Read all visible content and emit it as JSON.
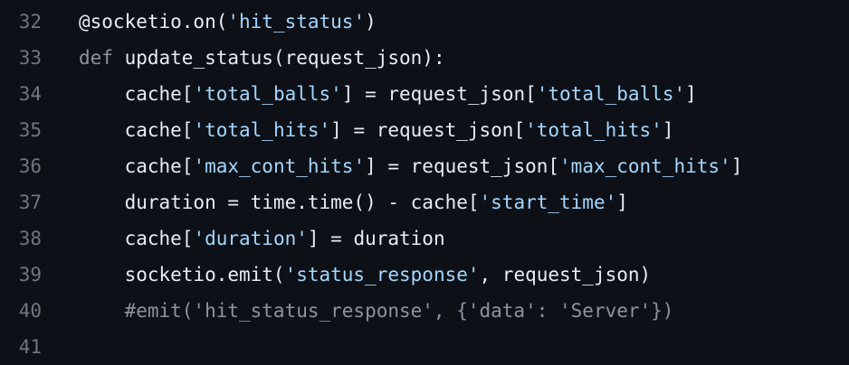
{
  "editor": {
    "lines": [
      {
        "number": "32",
        "tokens": [
          {
            "text": "@socketio.on(",
            "kind": "plain"
          },
          {
            "text": "'hit_status'",
            "kind": "str"
          },
          {
            "text": ")",
            "kind": "plain"
          }
        ]
      },
      {
        "number": "33",
        "tokens": [
          {
            "text": "def",
            "kind": "kw"
          },
          {
            "text": " update_status(request_json):",
            "kind": "plain"
          }
        ]
      },
      {
        "number": "34",
        "tokens": [
          {
            "text": "    cache[",
            "kind": "plain"
          },
          {
            "text": "'total_balls'",
            "kind": "str"
          },
          {
            "text": "] = request_json[",
            "kind": "plain"
          },
          {
            "text": "'total_balls'",
            "kind": "str"
          },
          {
            "text": "]",
            "kind": "plain"
          }
        ]
      },
      {
        "number": "35",
        "tokens": [
          {
            "text": "    cache[",
            "kind": "plain"
          },
          {
            "text": "'total_hits'",
            "kind": "str"
          },
          {
            "text": "] = request_json[",
            "kind": "plain"
          },
          {
            "text": "'total_hits'",
            "kind": "str"
          },
          {
            "text": "]",
            "kind": "plain"
          }
        ]
      },
      {
        "number": "36",
        "tokens": [
          {
            "text": "    cache[",
            "kind": "plain"
          },
          {
            "text": "'max_cont_hits'",
            "kind": "str"
          },
          {
            "text": "] = request_json[",
            "kind": "plain"
          },
          {
            "text": "'max_cont_hits'",
            "kind": "str"
          },
          {
            "text": "]",
            "kind": "plain"
          }
        ]
      },
      {
        "number": "37",
        "tokens": [
          {
            "text": "    duration = time.time() - cache[",
            "kind": "plain"
          },
          {
            "text": "'start_time'",
            "kind": "str"
          },
          {
            "text": "]",
            "kind": "plain"
          }
        ]
      },
      {
        "number": "38",
        "tokens": [
          {
            "text": "    cache[",
            "kind": "plain"
          },
          {
            "text": "'duration'",
            "kind": "str"
          },
          {
            "text": "] = duration",
            "kind": "plain"
          }
        ]
      },
      {
        "number": "39",
        "tokens": [
          {
            "text": "    socketio.emit(",
            "kind": "plain"
          },
          {
            "text": "'status_response'",
            "kind": "str"
          },
          {
            "text": ", request_json)",
            "kind": "plain"
          }
        ]
      },
      {
        "number": "40",
        "tokens": [
          {
            "text": "    #emit('hit_status_response', {'data': 'Server'})",
            "kind": "comment"
          }
        ]
      },
      {
        "number": "41",
        "tokens": [
          {
            "text": "",
            "kind": "plain"
          }
        ]
      }
    ]
  },
  "colors": {
    "background": "#0d1117",
    "plain_text": "#e6edf3",
    "string": "#a5d6ff",
    "keyword": "#8b949e",
    "comment": "#8b949e",
    "line_number": "#6e7681"
  }
}
